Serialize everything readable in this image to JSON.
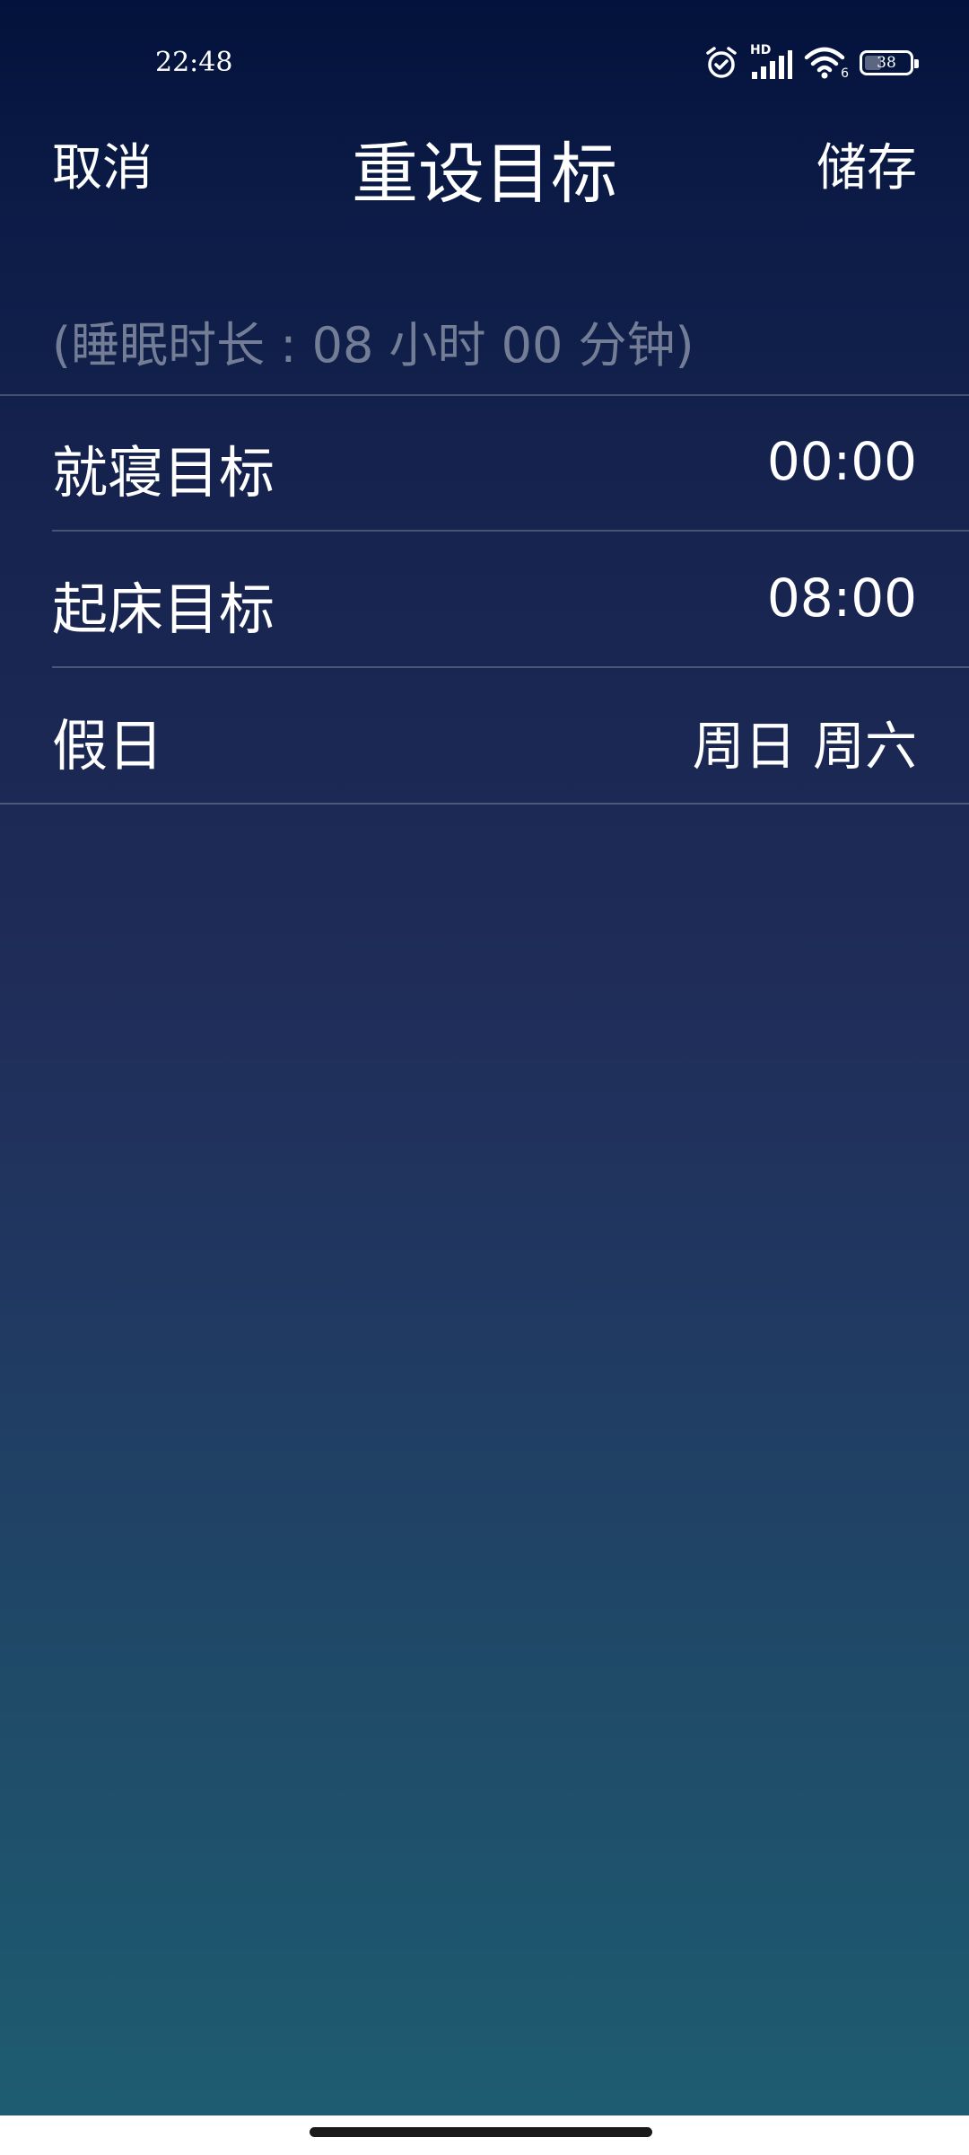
{
  "status_bar": {
    "time": "22:48",
    "battery_percent": 38,
    "battery_text": "38",
    "network_label": "HD",
    "wifi_label": "6",
    "icons": [
      "alarm-icon",
      "hd-signal-icon",
      "wifi-icon",
      "battery-icon"
    ]
  },
  "header": {
    "cancel_label": "取消",
    "title": "重设目标",
    "save_label": "储存"
  },
  "sleep_duration": "(睡眠时长 : 08 小时 00 分钟)",
  "rows": [
    {
      "label": "就寝目标",
      "value": "00:00"
    },
    {
      "label": "起床目标",
      "value": "08:00"
    },
    {
      "label": "假日",
      "value": "周日 周六"
    }
  ],
  "colors": {
    "background_top": "#02123b",
    "background_bottom": "#1e5e72",
    "text": "#ffffff",
    "muted_text": "#7b859e"
  }
}
